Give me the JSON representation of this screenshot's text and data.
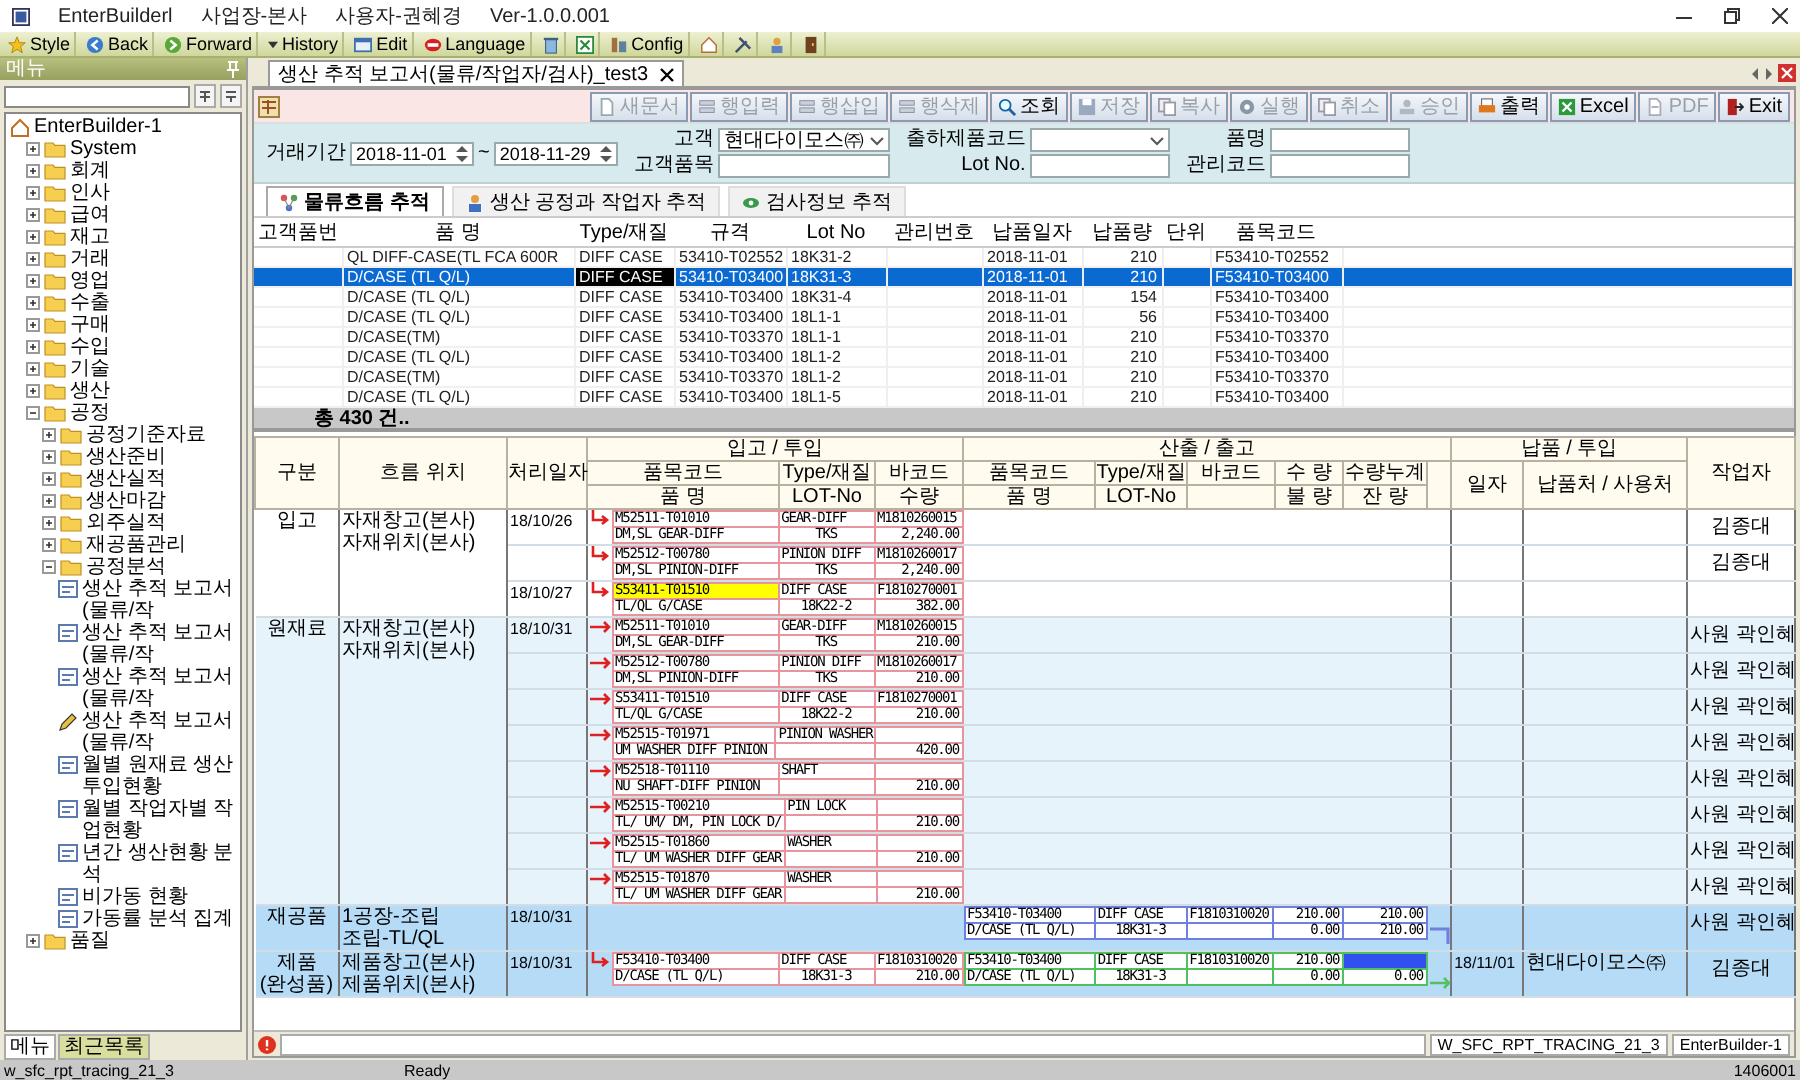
{
  "titlebar": {
    "app": "EnterBuilderl",
    "site": "사업장-본사",
    "user": "사용자-권혜경",
    "version": "Ver-1.0.0.001"
  },
  "toolbar": [
    {
      "kind": "star",
      "label": "Style"
    },
    {
      "kind": "back",
      "label": "Back"
    },
    {
      "kind": "forward",
      "label": "Forward"
    },
    {
      "kind": "caret",
      "label": "History"
    },
    {
      "kind": "edit",
      "label": "Edit"
    },
    {
      "kind": "language",
      "label": "Language"
    },
    {
      "kind": "trash"
    },
    {
      "kind": "sheet"
    },
    {
      "kind": "config",
      "label": "Config"
    },
    {
      "kind": "home"
    },
    {
      "kind": "tools"
    },
    {
      "kind": "person"
    },
    {
      "kind": "door"
    }
  ],
  "sidebar": {
    "title": "메뉴",
    "tree": {
      "kind": "root",
      "label": "EnterBuilder-1",
      "children": [
        {
          "kind": "folder",
          "label": "System",
          "expanded": false
        },
        {
          "kind": "folder",
          "label": "회계",
          "expanded": false
        },
        {
          "kind": "folder",
          "label": "인사",
          "expanded": false
        },
        {
          "kind": "folder",
          "label": "급여",
          "expanded": false
        },
        {
          "kind": "folder",
          "label": "재고",
          "expanded": false
        },
        {
          "kind": "folder",
          "label": "거래",
          "expanded": false
        },
        {
          "kind": "folder",
          "label": "영업",
          "expanded": false
        },
        {
          "kind": "folder",
          "label": "수출",
          "expanded": false
        },
        {
          "kind": "folder",
          "label": "구매",
          "expanded": false
        },
        {
          "kind": "folder",
          "label": "수입",
          "expanded": false
        },
        {
          "kind": "folder",
          "label": "기술",
          "expanded": false
        },
        {
          "kind": "folder",
          "label": "생산",
          "expanded": false
        },
        {
          "kind": "folder",
          "label": "공정",
          "expanded": true,
          "children": [
            {
              "kind": "folder",
              "label": "공정기준자료",
              "expanded": false
            },
            {
              "kind": "folder",
              "label": "생산준비",
              "expanded": false
            },
            {
              "kind": "folder",
              "label": "생산실적",
              "expanded": false
            },
            {
              "kind": "folder",
              "label": "생산마감",
              "expanded": false
            },
            {
              "kind": "folder",
              "label": "외주실적",
              "expanded": false
            },
            {
              "kind": "folder",
              "label": "재공품관리",
              "expanded": false
            },
            {
              "kind": "folder",
              "label": "공정분석",
              "expanded": true,
              "children": [
                {
                  "kind": "report",
                  "label": "생산 추적 보고서(물류/작"
                },
                {
                  "kind": "report",
                  "label": "생산 추적 보고서(물류/작"
                },
                {
                  "kind": "report",
                  "label": "생산 추적 보고서(물류/작"
                },
                {
                  "kind": "edit",
                  "label": "생산 추적 보고서(물류/작"
                },
                {
                  "kind": "report",
                  "label": "월별 원재료 생산투입현황"
                },
                {
                  "kind": "report",
                  "label": "월별 작업자별 작업현황"
                },
                {
                  "kind": "report",
                  "label": "년간 생산현황 분석"
                },
                {
                  "kind": "report",
                  "label": "비가동 현황"
                },
                {
                  "kind": "report",
                  "label": "가동률 분석 집계"
                }
              ]
            }
          ]
        },
        {
          "kind": "folder",
          "label": "품질",
          "expanded": false
        }
      ]
    },
    "tabs": [
      {
        "label": "메뉴",
        "selected": true
      },
      {
        "label": "최근목록",
        "selected": false
      }
    ]
  },
  "document_tab": {
    "title": "생산 추적 보고서(물류/작업자/검사)_test3"
  },
  "actions": [
    {
      "kind": "new",
      "label": "새문서",
      "disabled": true
    },
    {
      "kind": "rows",
      "label": "행입력",
      "disabled": true
    },
    {
      "kind": "rows",
      "label": "행삽입",
      "disabled": true
    },
    {
      "kind": "rows",
      "label": "행삭제",
      "disabled": true
    },
    {
      "kind": "search",
      "label": "조회",
      "disabled": false
    },
    {
      "kind": "save",
      "label": "저장",
      "disabled": true
    },
    {
      "kind": "copy",
      "label": "복사",
      "disabled": true
    },
    {
      "kind": "run",
      "label": "실행",
      "disabled": true
    },
    {
      "kind": "copy",
      "label": "취소",
      "disabled": true
    },
    {
      "kind": "approve",
      "label": "승인",
      "disabled": true
    },
    {
      "kind": "print",
      "label": "출력",
      "disabled": false
    },
    {
      "kind": "excel",
      "label": "Excel",
      "disabled": false
    },
    {
      "kind": "pdf",
      "label": "PDF",
      "disabled": true
    },
    {
      "kind": "exit",
      "label": "Exit",
      "disabled": false
    }
  ],
  "filters": {
    "period": {
      "label": "거래기간",
      "from": "2018-11-01",
      "separator": "~",
      "to": "2018-11-29"
    },
    "columns": [
      [
        {
          "kind": "combo",
          "label": "고객",
          "value": "현대다이모스㈜"
        },
        {
          "kind": "text",
          "label": "고객품목"
        }
      ],
      [
        {
          "kind": "combo",
          "label": "출하제품코드"
        },
        {
          "kind": "text",
          "label": "Lot No."
        }
      ],
      [
        {
          "kind": "text",
          "label": "품명"
        },
        {
          "kind": "text",
          "label": "관리코드"
        }
      ]
    ]
  },
  "view_tabs": [
    {
      "kind": "flow",
      "label": "물류흐름 추적",
      "selected": true
    },
    {
      "kind": "worker",
      "label": "생산 공정과 작업자 추적",
      "selected": false
    },
    {
      "kind": "inspect",
      "label": "검사정보 추적",
      "selected": false
    }
  ],
  "shipments": {
    "columns": [
      "고객품번",
      "품 명",
      "Type/재질",
      "규격",
      "Lot No",
      "관리번호",
      "납품일자",
      "납품량",
      "단위",
      "품목코드"
    ],
    "rows": [
      {
        "name": "QL DIFF-CASE(TL FCA 600R",
        "type": "DIFF CASE",
        "spec": "53410-T02552",
        "lot": "18K31-2",
        "date": "2018-11-01",
        "qty": "210",
        "code": "F53410-T02552",
        "selected": false,
        "focused": false
      },
      {
        "name": "D/CASE (TL Q/L)",
        "type": "DIFF CASE",
        "spec": "53410-T03400",
        "lot": "18K31-3",
        "date": "2018-11-01",
        "qty": "210",
        "code": "F53410-T03400",
        "selected": true,
        "focused": true
      },
      {
        "name": "D/CASE (TL Q/L)",
        "type": "DIFF CASE",
        "spec": "53410-T03400",
        "lot": "18K31-4",
        "date": "2018-11-01",
        "qty": "154",
        "code": "F53410-T03400",
        "selected": false,
        "focused": false
      },
      {
        "name": "D/CASE (TL Q/L)",
        "type": "DIFF CASE",
        "spec": "53410-T03400",
        "lot": "18L1-1",
        "date": "2018-11-01",
        "qty": "56",
        "code": "F53410-T03400",
        "selected": false,
        "focused": false
      },
      {
        "name": "D/CASE(TM)",
        "type": "DIFF CASE",
        "spec": "53410-T03370",
        "lot": "18L1-1",
        "date": "2018-11-01",
        "qty": "210",
        "code": "F53410-T03370",
        "selected": false,
        "focused": false
      },
      {
        "name": "D/CASE (TL Q/L)",
        "type": "DIFF CASE",
        "spec": "53410-T03400",
        "lot": "18L1-2",
        "date": "2018-11-01",
        "qty": "210",
        "code": "F53410-T03400",
        "selected": false,
        "focused": false
      },
      {
        "name": "D/CASE(TM)",
        "type": "DIFF CASE",
        "spec": "53410-T03370",
        "lot": "18L1-2",
        "date": "2018-11-01",
        "qty": "210",
        "code": "F53410-T03370",
        "selected": false,
        "focused": false
      },
      {
        "name": "D/CASE (TL Q/L)",
        "type": "DIFF CASE",
        "spec": "53410-T03400",
        "lot": "18L1-5",
        "date": "2018-11-01",
        "qty": "210",
        "code": "F53410-T03400",
        "selected": false,
        "focused": false
      }
    ],
    "total": "총 430 건.."
  },
  "tracking": {
    "headers": {
      "section": "구분",
      "location": "흐름 위치",
      "date": "처리일자",
      "input": "입고 / 투입",
      "input_cols": [
        [
          "품목코드",
          "품 명"
        ],
        [
          "Type/재질",
          "LOT-No"
        ],
        [
          "바코드",
          "수량"
        ]
      ],
      "output": "산출 / 출고",
      "output_cols": [
        [
          "품목코드",
          "품 명"
        ],
        [
          "Type/재질",
          "LOT-No"
        ],
        [
          "바코드"
        ],
        [
          "수 량",
          "불 량"
        ],
        [
          "수량누계",
          "잔 량"
        ]
      ],
      "delivery": "납품 / 투입",
      "delivery_cols": [
        "일자",
        "납품처 / 사용처"
      ],
      "worker": "작업자"
    },
    "groups": [
      {
        "section": [
          "입고"
        ],
        "location": [
          "자재창고(본사)",
          "자재위치(본사)"
        ],
        "color": "#ffffff",
        "rows": [
          {
            "date": "18/10/26",
            "input": {
              "kind": "hook",
              "code": "M52511-T01010",
              "name": "DM,SL GEAR-DIFF",
              "type": "GEAR-DIFF",
              "lot": "TKS",
              "barcode": "M1810260015",
              "qty": "2,240.00",
              "highlighted": false
            },
            "worker": "김종대"
          },
          {
            "input": {
              "kind": "hook",
              "code": "M52512-T00780",
              "name": "DM,SL PINION-DIFF",
              "type": "PINION DIFF",
              "lot": "TKS",
              "barcode": "M1810260017",
              "qty": "2,240.00",
              "highlighted": false
            },
            "worker": "김종대"
          },
          {
            "date": "18/10/27",
            "input": {
              "kind": "hook",
              "code": "S53411-T01510",
              "name": "TL/QL G/CASE",
              "type": "DIFF CASE",
              "lot": "18K22-2",
              "barcode": "F1810270001",
              "qty": "382.00",
              "highlighted": true
            }
          }
        ]
      },
      {
        "section": [
          "원재료"
        ],
        "location": [
          "자재창고(본사)",
          "자재위치(본사)"
        ],
        "color": "#e6f3fb",
        "rows": [
          {
            "date": "18/10/31",
            "input": {
              "kind": "straight",
              "code": "M52511-T01010",
              "name": "DM,SL GEAR-DIFF",
              "type": "GEAR-DIFF",
              "lot": "TKS",
              "barcode": "M1810260015",
              "qty": "210.00",
              "highlighted": false
            },
            "worker": "사원 곽인혜"
          },
          {
            "input": {
              "kind": "straight",
              "code": "M52512-T00780",
              "name": "DM,SL PINION-DIFF",
              "type": "PINION DIFF",
              "lot": "TKS",
              "barcode": "M1810260017",
              "qty": "210.00",
              "highlighted": false
            },
            "worker": "사원 곽인혜"
          },
          {
            "input": {
              "kind": "straight",
              "code": "S53411-T01510",
              "name": "TL/QL G/CASE",
              "type": "DIFF CASE",
              "lot": "18K22-2",
              "barcode": "F1810270001",
              "qty": "210.00",
              "highlighted": false
            },
            "worker": "사원 곽인혜"
          },
          {
            "input": {
              "kind": "straight",
              "code": "M52515-T01971",
              "name": "UM WASHER DIFF PINION",
              "type": "PINION WASHER",
              "qty": "420.00",
              "highlighted": false
            },
            "worker": "사원 곽인혜"
          },
          {
            "input": {
              "kind": "straight",
              "code": "M52518-T01110",
              "name": "NU SHAFT-DIFF PINION",
              "type": "SHAFT",
              "qty": "210.00",
              "highlighted": false
            },
            "worker": "사원 곽인혜"
          },
          {
            "input": {
              "kind": "straight",
              "code": "M52515-T00210",
              "name": "TL/ UM/ DM, PIN LOCK D/",
              "type": "PIN LOCK",
              "qty": "210.00",
              "highlighted": false
            },
            "worker": "사원 곽인혜"
          },
          {
            "input": {
              "kind": "straight",
              "code": "M52515-T01860",
              "name": "TL/ UM WASHER DIFF GEAR",
              "type": "WASHER",
              "qty": "210.00",
              "highlighted": false
            },
            "worker": "사원 곽인혜"
          },
          {
            "input": {
              "kind": "straight",
              "code": "M52515-T01870",
              "name": "TL/ UM WASHER DIFF GEAR",
              "type": "WASHER",
              "qty": "210.00",
              "highlighted": false
            },
            "worker": "사원 곽인혜"
          }
        ]
      },
      {
        "section": [
          "재공품"
        ],
        "location": [
          "1공장-조립",
          "조립-TL/QL"
        ],
        "color": "#b6dbf7",
        "rows": [
          {
            "date": "18/10/31",
            "output": {
              "kind": "corner",
              "color": "#7080e0",
              "code": "F53410-T03400",
              "name": "D/CASE (TL Q/L)",
              "type": "DIFF CASE",
              "lot": "18K31-3",
              "barcode": "F1810310020",
              "qty": "210.00",
              "defect": "0.00",
              "cumulative": "210.00",
              "remaining": "210.00",
              "highlighted": false
            },
            "worker": "사원 곽인혜"
          }
        ]
      },
      {
        "section": [
          "제품",
          "(완성품)"
        ],
        "location": [
          "제품창고(본사)",
          "제품위치(본사)"
        ],
        "color": "#b6dbf7",
        "rows": [
          {
            "date": "18/10/31",
            "input": {
              "kind": "hook",
              "code": "F53410-T03400",
              "name": "D/CASE (TL Q/L)",
              "type": "DIFF CASE",
              "lot": "18K31-3",
              "barcode": "F1810310020",
              "qty": "210.00",
              "highlighted": false
            },
            "output": {
              "kind": "straight",
              "color": "#50c060",
              "code": "F53410-T03400",
              "name": "D/CASE (TL Q/L)",
              "type": "DIFF CASE",
              "lot": "18K31-3",
              "barcode": "F1810310020",
              "qty": "210.00",
              "defect": "0.00",
              "remaining": "0.00",
              "highlighted": true
            },
            "delivery": {
              "date": "18/11/01",
              "place": "현대다이모스㈜"
            },
            "worker": "김종대"
          }
        ]
      }
    ]
  },
  "status": {
    "form": "W_SFC_RPT_TRACING_21_3",
    "app": "EnterBuilder-1"
  },
  "statusbar": {
    "object": "w_sfc_rpt_tracing_21_3",
    "state": "Ready",
    "code": "1406001"
  }
}
